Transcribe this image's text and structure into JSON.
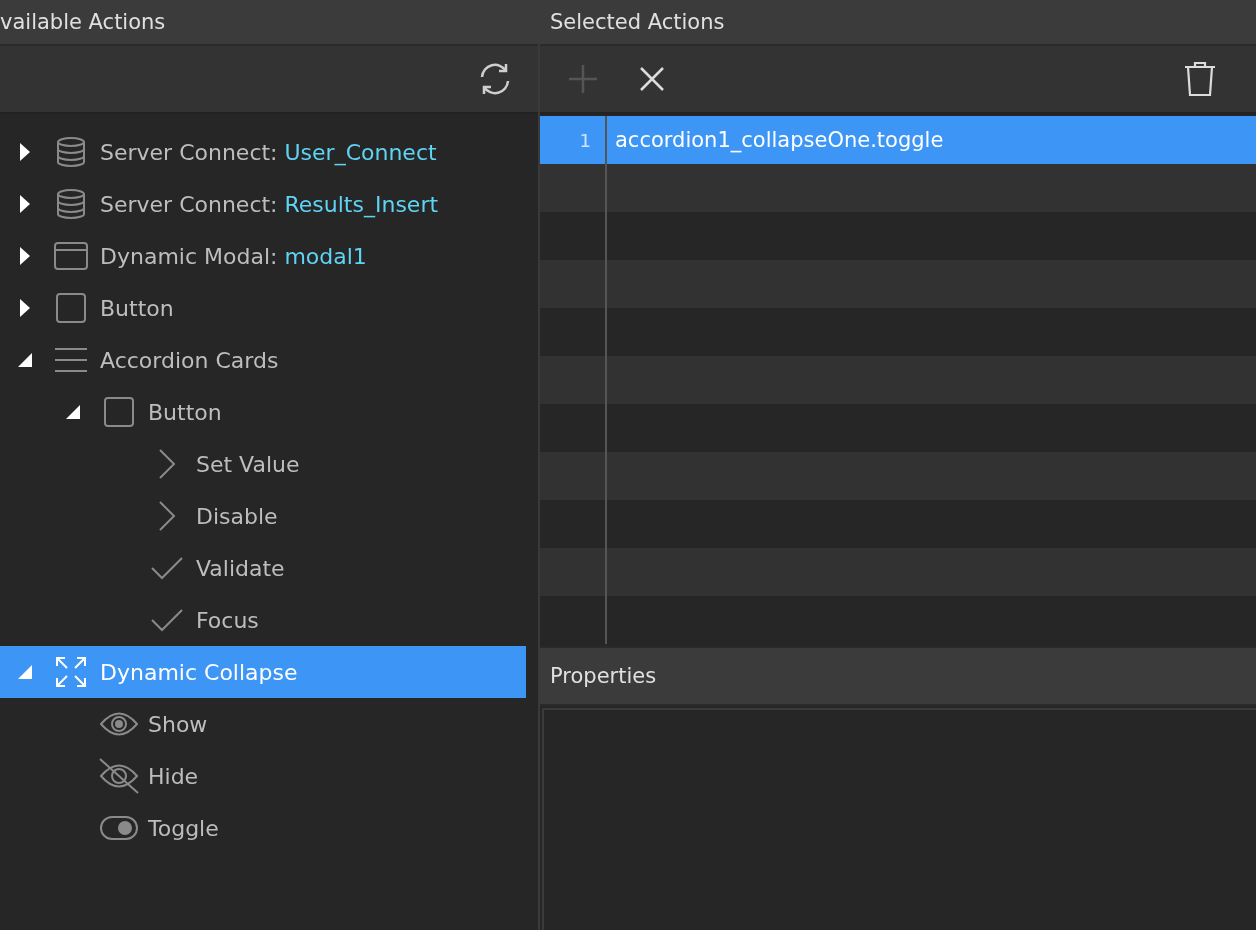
{
  "left_panel": {
    "title": "vailable Actions"
  },
  "tree": [
    {
      "kind": "database",
      "label": "Server Connect: ",
      "name": "User_Connect",
      "expanded": false,
      "selected": false
    },
    {
      "kind": "database",
      "label": "Server Connect: ",
      "name": "Results_Insert",
      "expanded": false,
      "selected": false
    },
    {
      "kind": "modal",
      "label": "Dynamic Modal: ",
      "name": "modal1",
      "expanded": false,
      "selected": false
    },
    {
      "kind": "button",
      "label": "Button",
      "expanded": false,
      "selected": false
    },
    {
      "kind": "list",
      "label": "Accordion Cards",
      "expanded": true,
      "selected": false,
      "children": [
        {
          "kind": "button",
          "label": "Button",
          "expanded": true,
          "selected": false,
          "children": [
            {
              "kind": "chevron",
              "label": "Set Value",
              "selected": false
            },
            {
              "kind": "chevron",
              "label": "Disable",
              "selected": false
            },
            {
              "kind": "check",
              "label": "Validate",
              "selected": false
            },
            {
              "kind": "check",
              "label": "Focus",
              "selected": false
            }
          ]
        }
      ]
    },
    {
      "kind": "expand",
      "label": "Dynamic Collapse",
      "expanded": true,
      "selected": true,
      "children": [
        {
          "kind": "eye",
          "label": "Show",
          "selected": false
        },
        {
          "kind": "eye-off",
          "label": "Hide",
          "selected": false
        },
        {
          "kind": "toggle",
          "label": "Toggle",
          "selected": false
        }
      ]
    }
  ],
  "right_panel": {
    "title": "Selected Actions",
    "add_disabled": true
  },
  "actions": [
    {
      "number": "1",
      "text": "accordion1_collapseOne.toggle",
      "selected": true
    }
  ],
  "properties": {
    "title": "Properties"
  }
}
